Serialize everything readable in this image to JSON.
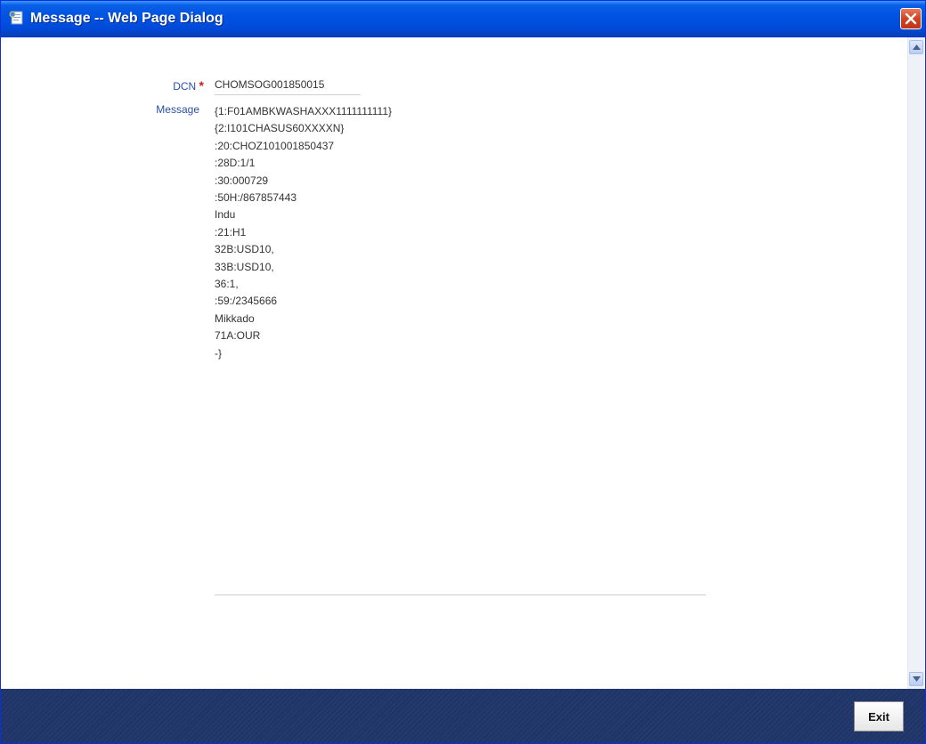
{
  "window": {
    "title": "Message -- Web Page Dialog"
  },
  "form": {
    "dcn_label": "DCN",
    "required_mark": "*",
    "dcn_value": "CHOMSOG001850015",
    "message_label": "Message",
    "message_lines": [
      "{1:F01AMBKWASHAXXX1111111111}",
      "{2:I101CHASUS60XXXXN}",
      ":20:CHOZ101001850437",
      ":28D:1/1",
      ":30:000729",
      ":50H:/867857443",
      "Indu",
      ":21:H1",
      "32B:USD10,",
      "33B:USD10,",
      "36:1,",
      ":59:/2345666",
      "Mikkado",
      "71A:OUR",
      "-}"
    ]
  },
  "footer": {
    "exit_label": "Exit"
  },
  "icons": {
    "title_icon": "ie-page-icon",
    "close": "close-icon",
    "scroll_up": "arrow-up-icon",
    "scroll_down": "arrow-down-icon"
  },
  "colors": {
    "titlebar": "#0054e3",
    "label": "#2a4fa8",
    "required": "#d11a1a",
    "footer": "#1f3468"
  }
}
